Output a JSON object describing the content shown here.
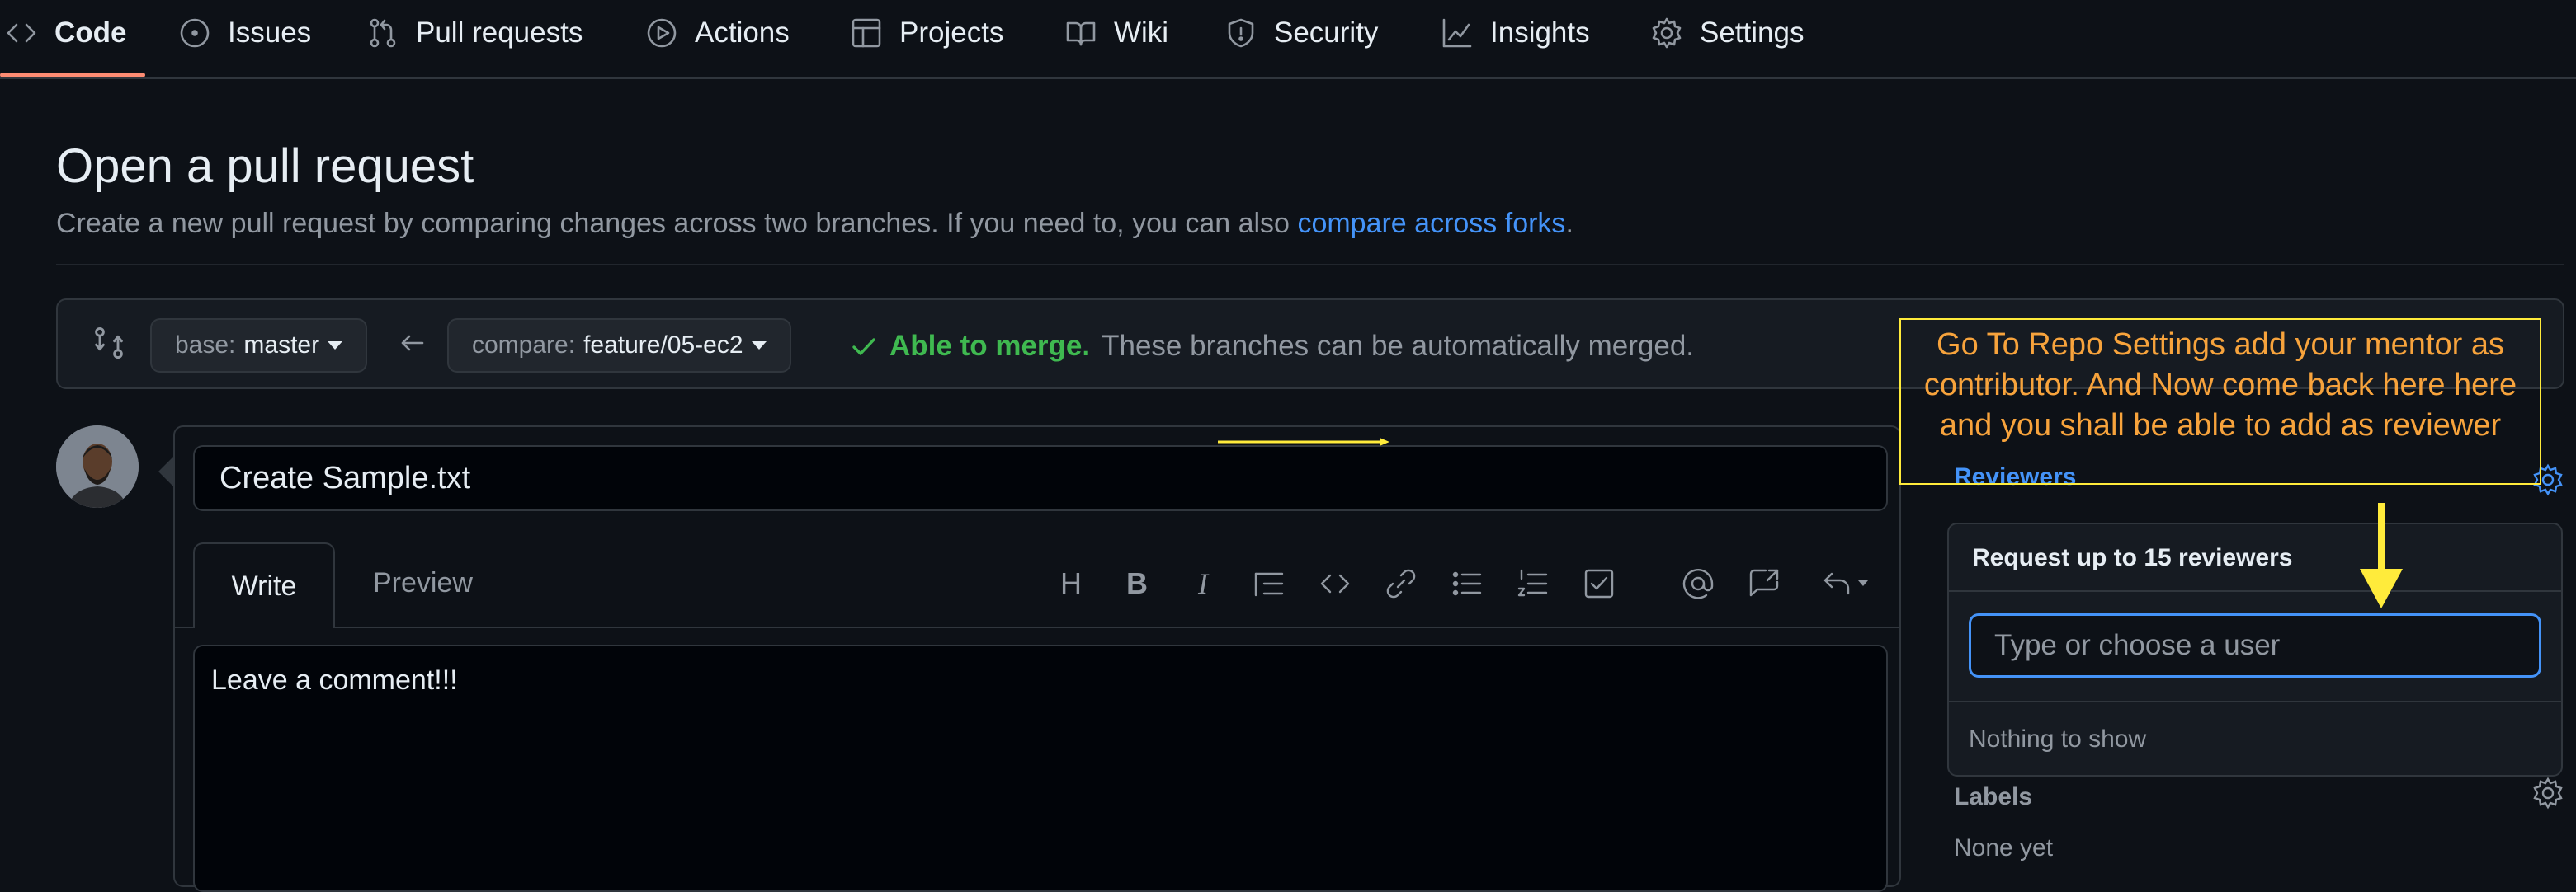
{
  "nav": {
    "tabs": [
      {
        "label": "Code",
        "icon": "code-icon"
      },
      {
        "label": "Issues",
        "icon": "issue-icon"
      },
      {
        "label": "Pull requests",
        "icon": "pull-request-icon"
      },
      {
        "label": "Actions",
        "icon": "play-icon"
      },
      {
        "label": "Projects",
        "icon": "table-icon"
      },
      {
        "label": "Wiki",
        "icon": "book-icon"
      },
      {
        "label": "Security",
        "icon": "shield-icon"
      },
      {
        "label": "Insights",
        "icon": "graph-icon"
      },
      {
        "label": "Settings",
        "icon": "gear-icon"
      }
    ],
    "active_tab": "Code"
  },
  "header": {
    "title": "Open a pull request",
    "subtitle_text": "Create a new pull request by comparing changes across two branches. If you need to, you can also",
    "subtitle_link": "compare across forks",
    "subtitle_end": "."
  },
  "range": {
    "base_prefix": "base:",
    "base_branch": "master",
    "compare_prefix": "compare:",
    "compare_branch": "feature/05-ec2",
    "merge_ok": "Able to merge.",
    "merge_msg": "These branches can be automatically merged."
  },
  "editor": {
    "title_value": "Create Sample.txt",
    "tab_write": "Write",
    "tab_preview": "Preview",
    "toolbar_glyphs": {
      "heading": "H",
      "bold": "B",
      "italic": "I"
    },
    "comment_value": "Leave a comment!!!"
  },
  "annotation": {
    "text": "Go To Repo Settings add your mentor as contributor. And Now come  back here here and you shall be able to add as reviewer"
  },
  "sidebar": {
    "reviewers_label": "Reviewers",
    "dropdown_header": "Request up to 15 reviewers",
    "dropdown_placeholder": "Type or choose a user",
    "dropdown_empty": "Nothing to show",
    "labels_label": "Labels",
    "labels_value": "None yet"
  },
  "colors": {
    "accent_link": "#4493f8",
    "success": "#3fb950",
    "annotation_border": "#ffeb3b",
    "annotation_text": "#f7a33c",
    "active_tab_underline": "#fd8c73"
  }
}
